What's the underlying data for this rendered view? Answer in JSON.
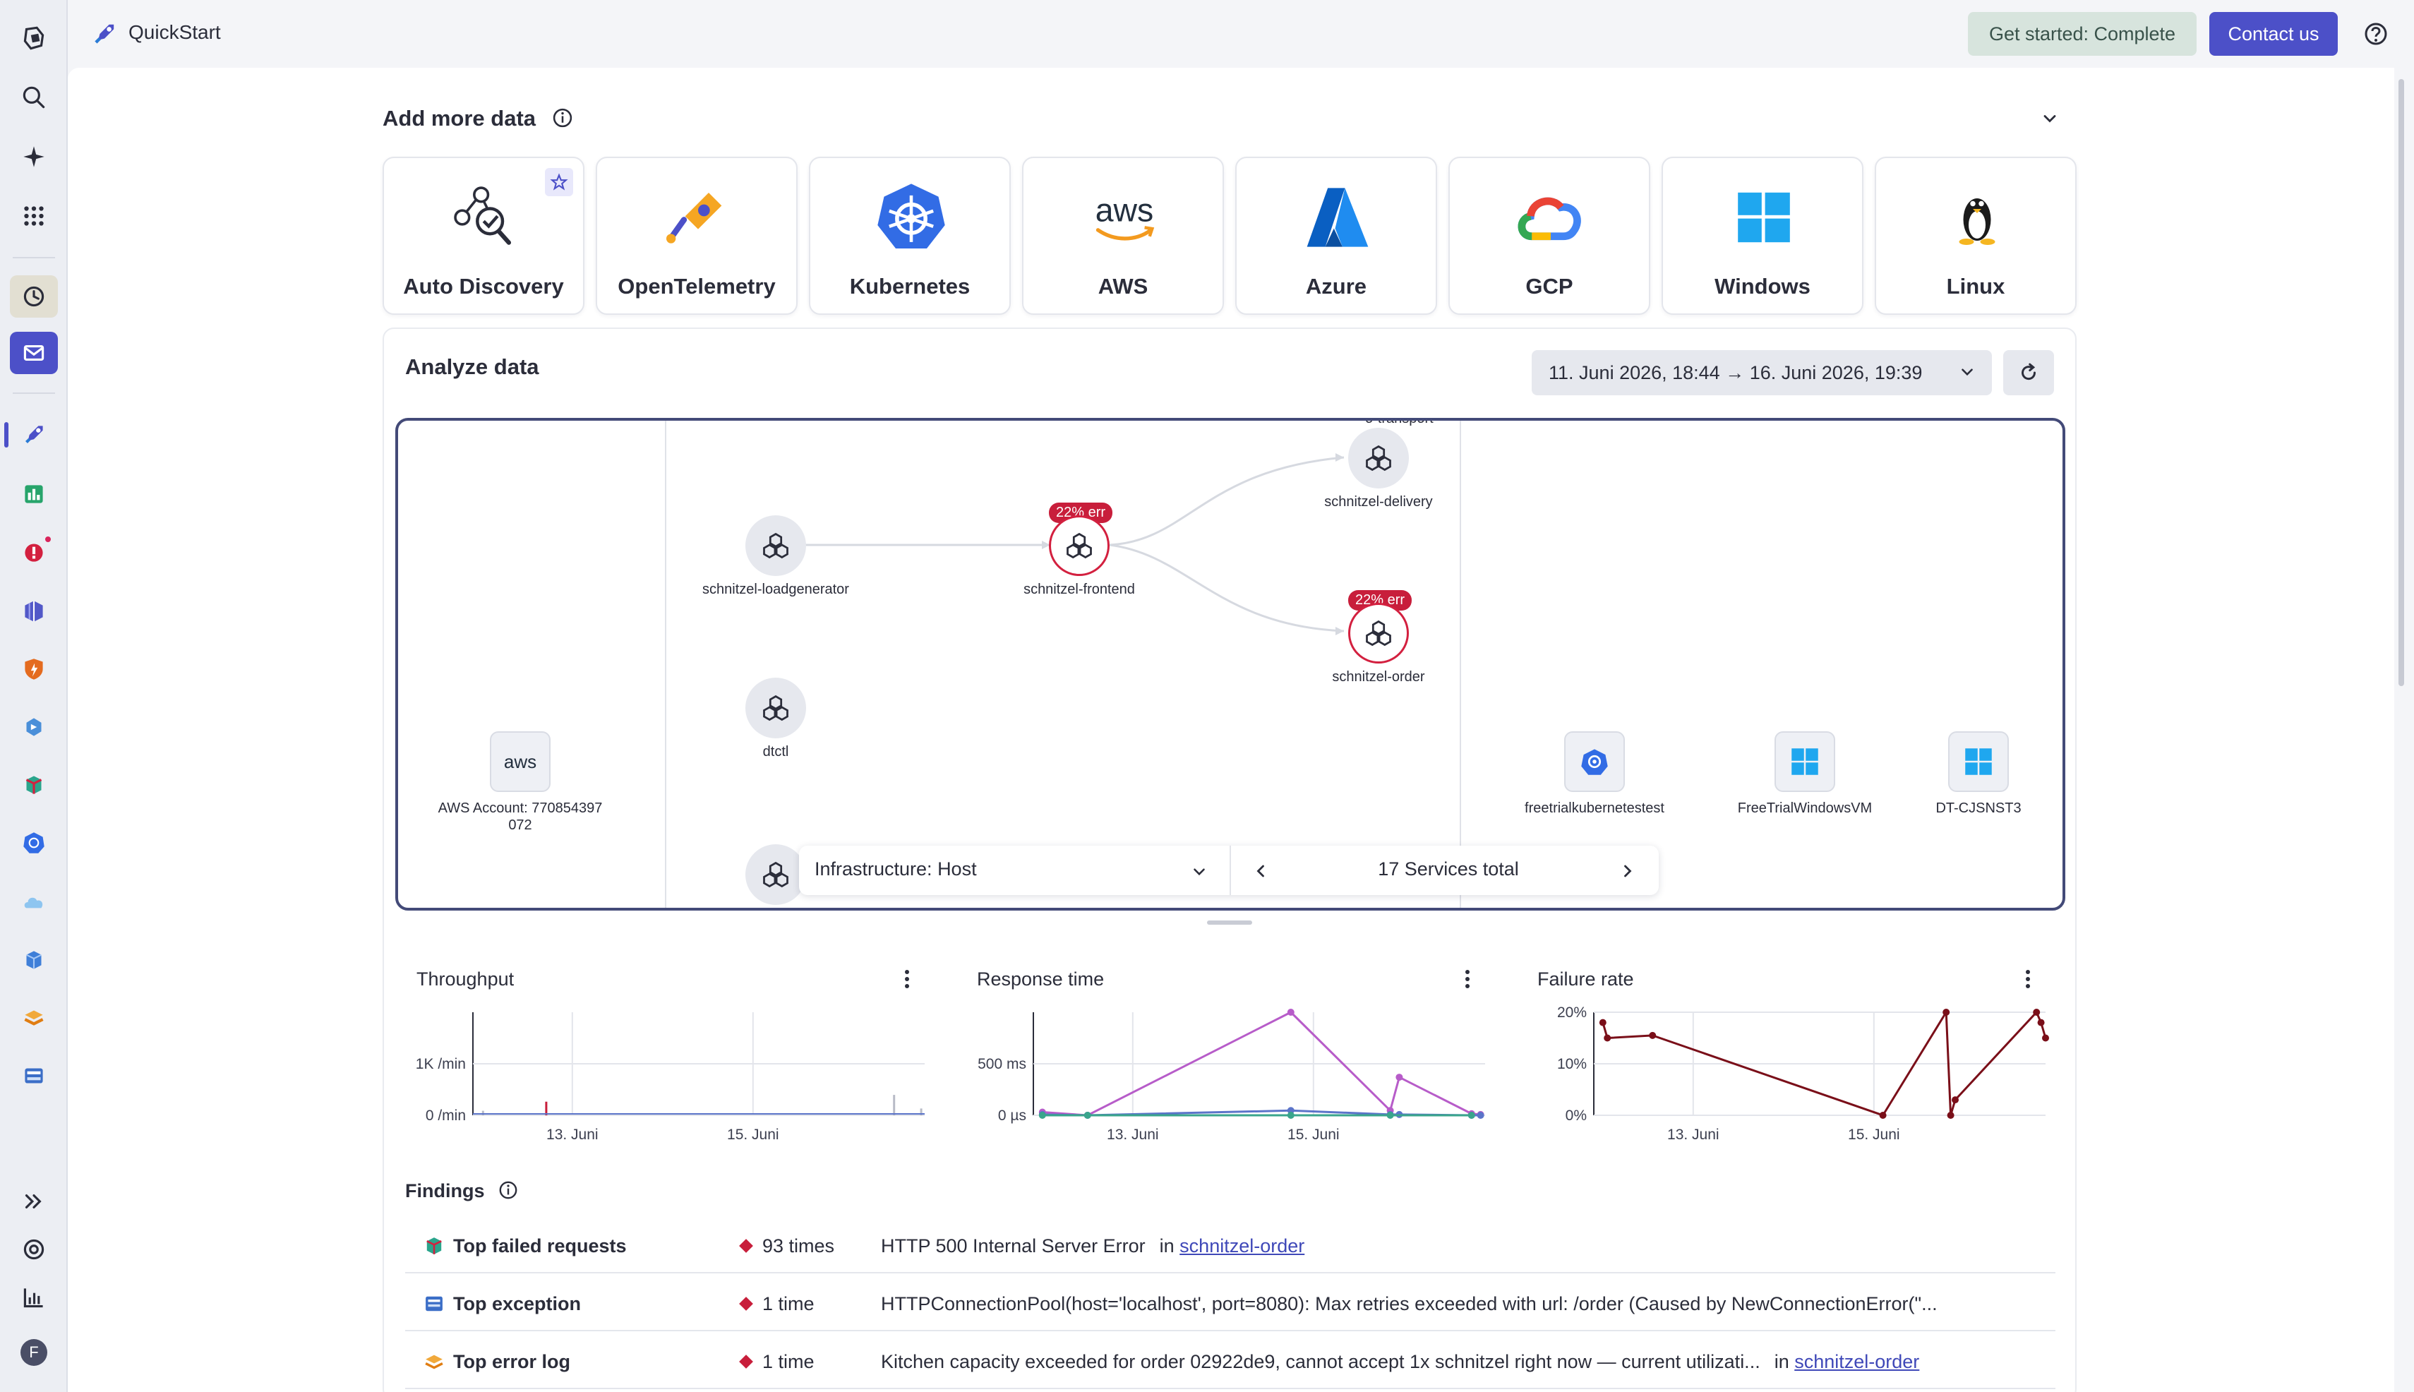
{
  "app": {
    "title": "QuickStart"
  },
  "header": {
    "get_started_label": "Get started: Complete",
    "contact_label": "Contact us"
  },
  "add_data": {
    "title": "Add more data",
    "tiles": [
      {
        "label": "Auto Discovery"
      },
      {
        "label": "OpenTelemetry"
      },
      {
        "label": "Kubernetes"
      },
      {
        "label": "AWS"
      },
      {
        "label": "Azure"
      },
      {
        "label": "GCP"
      },
      {
        "label": "Windows"
      },
      {
        "label": "Linux"
      }
    ]
  },
  "analyze": {
    "title": "Analyze data",
    "time_range": "11. Juni 2026, 18:44 → 16. Juni 2026, 19:39"
  },
  "topology": {
    "cropped_label": "o-transport",
    "aws_account": "AWS Account: 770854397",
    "aws_account_line2": "072",
    "aws_logo_text": "aws",
    "nodes": {
      "loadgenerator": "schnitzel-loadgenerator",
      "frontend": "schnitzel-frontend",
      "delivery": "schnitzel-delivery",
      "order": "schnitzel-order",
      "dtctl": "dtctl"
    },
    "frontend_err": "22% err",
    "order_err": "22% err",
    "hosts": [
      "freetrialkubernetestest",
      "FreeTrialWindowsVM",
      "DT-CJSNST3"
    ],
    "toolbar": {
      "selector": "Infrastructure: Host",
      "count": "17 Services total"
    }
  },
  "charts": {
    "throughput": {
      "title": "Throughput"
    },
    "response": {
      "title": "Response time"
    },
    "failure": {
      "title": "Failure rate"
    }
  },
  "chart_data": [
    {
      "type": "bar",
      "title": "Throughput",
      "y_ticks": [
        "1K /min",
        "0 /min"
      ],
      "x_ticks": [
        "13. Juni",
        "15. Juni"
      ],
      "bars": [
        {
          "x": "11. Juni",
          "value": 40
        },
        {
          "x": "12. Juni",
          "value": 120
        },
        {
          "x": "16. Juni",
          "value": 180
        },
        {
          "x": "16. Juni",
          "value": 60
        }
      ]
    },
    {
      "type": "line",
      "title": "Response time",
      "y_ticks": [
        "500 ms",
        "0 µs"
      ],
      "x_ticks": [
        "13. Juni",
        "15. Juni"
      ],
      "ylim": [
        0,
        650
      ],
      "series": [
        {
          "color": "#b75cc9",
          "points": [
            [
              0.02,
              20
            ],
            [
              0.12,
              0
            ],
            [
              0.57,
              650
            ],
            [
              0.79,
              30
            ],
            [
              0.81,
              240
            ],
            [
              0.97,
              10
            ],
            [
              0.99,
              5
            ]
          ]
        },
        {
          "color": "#5b74c9",
          "points": [
            [
              0.02,
              5
            ],
            [
              0.12,
              0
            ],
            [
              0.57,
              30
            ],
            [
              0.79,
              5
            ],
            [
              0.81,
              5
            ],
            [
              0.97,
              0
            ],
            [
              0.99,
              0
            ]
          ]
        },
        {
          "color": "#3aa58c",
          "points": [
            [
              0.02,
              0
            ],
            [
              0.12,
              0
            ],
            [
              0.57,
              0
            ],
            [
              0.79,
              0
            ],
            [
              0.97,
              0
            ]
          ]
        }
      ]
    },
    {
      "type": "line",
      "title": "Failure rate",
      "y_ticks": [
        "20%",
        "10%",
        "0%"
      ],
      "x_ticks": [
        "13. Juni",
        "15. Juni"
      ],
      "ylim": [
        0,
        20
      ],
      "series": [
        {
          "color": "#7a0f19",
          "points": [
            [
              0.02,
              18
            ],
            [
              0.03,
              15
            ],
            [
              0.13,
              15.5
            ],
            [
              0.64,
              0
            ],
            [
              0.78,
              20
            ],
            [
              0.79,
              0
            ],
            [
              0.8,
              3
            ],
            [
              0.98,
              20
            ],
            [
              0.99,
              18
            ],
            [
              1.0,
              15
            ]
          ]
        }
      ]
    }
  ],
  "findings": {
    "title": "Findings",
    "rows": [
      {
        "label": "Top failed requests",
        "count": "93 times",
        "message": "HTTP 500 Internal Server Error",
        "in": "in",
        "link": "schnitzel-order"
      },
      {
        "label": "Top exception",
        "count": "1 time",
        "message": "HTTPConnectionPool(host='localhost', port=8080): Max retries exceeded with url: /order (Caused by NewConnectionError(\"...",
        "in": "",
        "link": ""
      },
      {
        "label": "Top error log",
        "count": "1 time",
        "message": "Kitchen capacity exceeded for order 02922de9, cannot accept 1x schnitzel right now — current utilizati...",
        "in": "in",
        "link": "schnitzel-order"
      }
    ]
  },
  "user": {
    "avatar_letter": "F"
  }
}
